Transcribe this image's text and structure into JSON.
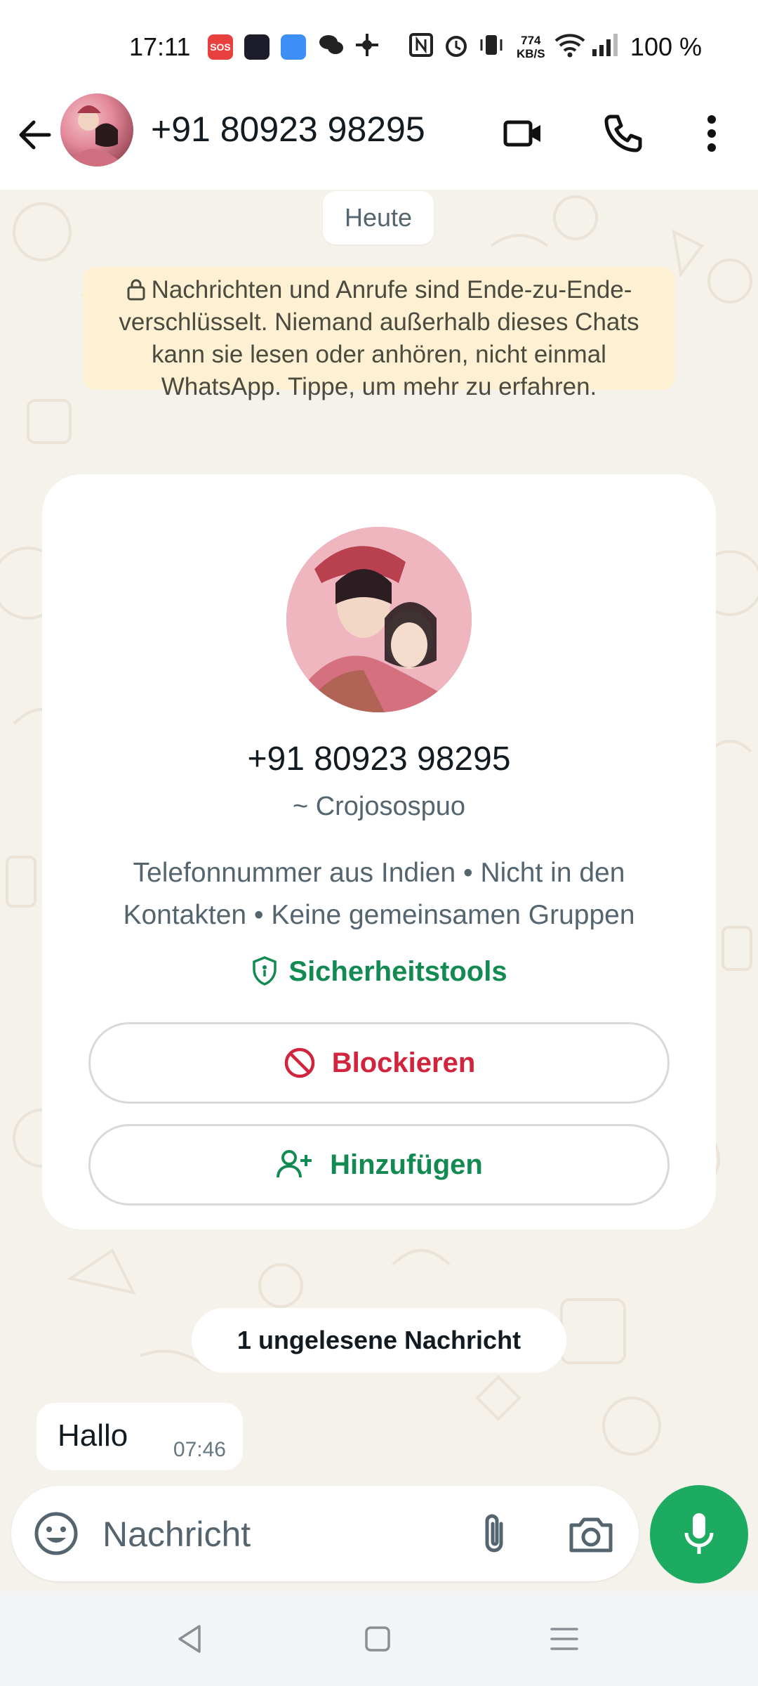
{
  "status_bar": {
    "time": "17:11",
    "net_speed_value": "774",
    "net_speed_unit": "KB/S",
    "battery": "100 %",
    "icons": [
      "sos-icon",
      "news-app-icon",
      "weather-icon",
      "wechat-icon",
      "pinwheel-icon",
      "nfc-icon",
      "alarm-icon",
      "vibrate-icon",
      "wifi-icon",
      "signal-icon"
    ]
  },
  "app_bar": {
    "contact_name": "+91 80923 98295",
    "icons": [
      "back-arrow-icon",
      "video-call-icon",
      "phone-call-icon",
      "more-vert-icon"
    ]
  },
  "chat": {
    "date_chip": "Heute",
    "encryption_notice": "Nachrichten und Anrufe sind Ende-zu-Ende-verschlüsselt. Niemand außerhalb dieses Chats kann sie lesen oder anhören, nicht einmal WhatsApp. Tippe, um mehr zu erfahren.",
    "contact_card": {
      "phone": "+91 80923 98295",
      "push_name": "~ Crojosospuo",
      "info": "Telefonnummer aus Indien • Nicht in den Kontakten • Keine gemeinsamen Gruppen",
      "safety_tools_label": "Sicherheitstools",
      "block_label": "Blockieren",
      "add_label": "Hinzufügen"
    },
    "unread_chip": "1 ungelesene Nachricht",
    "messages": [
      {
        "text": "Hallo",
        "time": "07:46"
      }
    ]
  },
  "composer": {
    "placeholder": "Nachricht"
  },
  "colors": {
    "accent_green": "#1daa61",
    "safety_green": "#128a52",
    "block_red": "#d0253c",
    "notice_bg": "#fdf0d3",
    "chat_bg": "#f5f1eb"
  }
}
